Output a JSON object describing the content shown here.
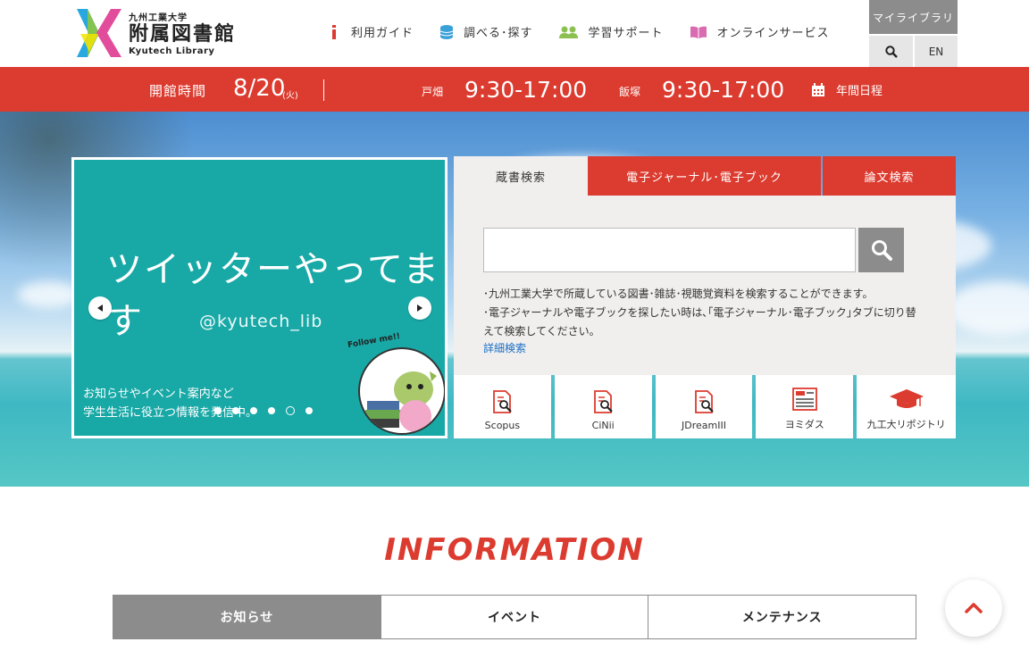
{
  "header": {
    "logo": {
      "sub": "九州工業大学",
      "main": "附属図書館",
      "en": "Kyutech Library"
    },
    "nav": [
      {
        "label": "利用ガイド",
        "icon": "info-icon",
        "color": "#dc3b2f"
      },
      {
        "label": "調べる･探す",
        "icon": "database-icon",
        "color": "#3aa0d8"
      },
      {
        "label": "学習サポート",
        "icon": "users-icon",
        "color": "#8cc152"
      },
      {
        "label": "オンラインサービス",
        "icon": "book-icon",
        "color": "#d96bb0"
      }
    ],
    "mylibrary": "マイライブラリ",
    "lang": "EN"
  },
  "hours": {
    "label": "開館時間",
    "date": "8/20",
    "dow": "(火)",
    "campus1": "戸畑",
    "time1": "9:30-17:00",
    "campus2": "飯塚",
    "time2": "9:30-17:00",
    "calendar": "年間日程"
  },
  "slider": {
    "title": "ツイッターやってます",
    "handle": "@kyutech_lib",
    "follow": "Follow me!!",
    "caption_line1": "お知らせやイベント案内など",
    "caption_line2": "学生生活に役立つ情報を発信中。",
    "dots": 6,
    "active_dot": 4
  },
  "search": {
    "tabs": [
      "蔵書検索",
      "電子ジャーナル･電子ブック",
      "論文検索"
    ],
    "placeholder": "",
    "desc1": "･九州工業大学で所蔵している図書･雑誌･視聴覚資料を検索することができます。",
    "desc2": "･電子ジャーナルや電子ブックを探したい時は､｢電子ジャーナル･電子ブック｣タブに切り替えて検索してください。",
    "advanced": "詳細検索",
    "databases": [
      {
        "label": "Scopus",
        "icon": "doc-search-icon"
      },
      {
        "label": "CiNii",
        "icon": "doc-search-icon"
      },
      {
        "label": "JDreamIII",
        "icon": "doc-search-icon"
      },
      {
        "label": "ヨミダス",
        "icon": "news-icon"
      },
      {
        "label": "九工大リポジトリ",
        "icon": "graduation-cap-icon"
      }
    ]
  },
  "information": {
    "title": "INFORMATION",
    "tabs": [
      "お知らせ",
      "イベント",
      "メンテナンス"
    ]
  },
  "colors": {
    "accent_red": "#dc3b2f",
    "gray": "#8c8c8c",
    "panel_bg": "#f1efee",
    "slide_teal": "#18a9a7"
  }
}
